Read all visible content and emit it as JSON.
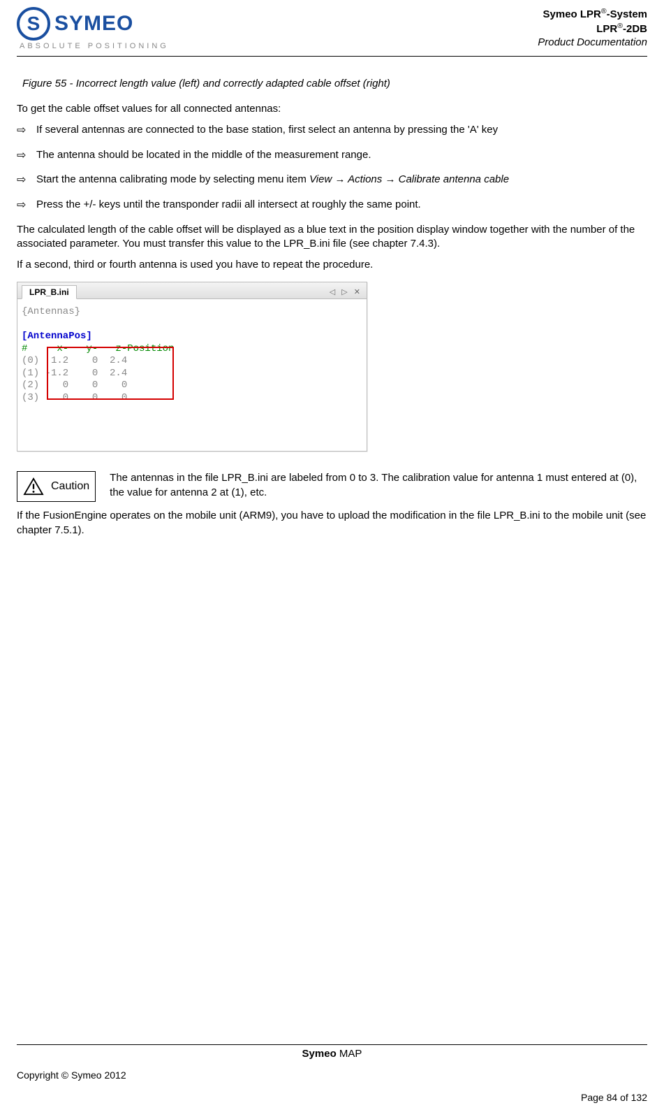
{
  "header": {
    "logo_letter": "S",
    "logo_name": "SYMEO",
    "logo_sub": "ABSOLUTE POSITIONING",
    "line1a": "Symeo LPR",
    "line1b": "-System",
    "line2a": "LPR",
    "line2b": "-2DB",
    "line3": "Product Documentation"
  },
  "figure_caption": "Figure 55 - Incorrect length value (left) and correctly adapted cable offset (right)",
  "intro": "To get the cable offset values for all connected antennas:",
  "bullets": [
    "If several antennas are connected to the base station, first select an antenna by pressing the 'A' key",
    "The antenna should be located in the middle of the measurement range.",
    "Start the antenna calibrating mode by selecting menu item ",
    "Press the +/- keys until the transponder radii all intersect at roughly the same point."
  ],
  "menu_path": "View → Actions → Calibrate antenna cable",
  "para_after_bullets": "The calculated length of the cable offset will be displayed as a blue text in the position display window together with the number of the associated parameter. You must transfer this value to the LPR_B.ini file (see chapter 7.4.3).",
  "para_repeat": "If a second, third or fourth antenna is used you have to repeat the procedure.",
  "ini": {
    "tab_label": "LPR_B.ini",
    "tab_controls": "◁ ▷ ✕",
    "line_section1": "{Antennas}",
    "line_section2": "[AntennaPos]",
    "line_header": "#     x-   y-   z-Position",
    "rows": [
      "(0)  1.2    0  2.4",
      "(1) -1.2    0  2.4",
      "(2)    0    0    0",
      "(3)    0    0    0"
    ]
  },
  "caution": {
    "label": "Caution",
    "text": "The antennas in the file LPR_B.ini are labeled from 0 to 3. The calibration value for antenna 1 must entered at (0), the value for antenna 2 at (1), etc."
  },
  "para_fusion": "If the FusionEngine operates on the mobile unit (ARM9), you have to upload the modification in the file LPR_B.ini to the mobile unit (see chapter 7.5.1).",
  "footer": {
    "center_a": "Symeo",
    "center_b": " MAP",
    "copyright": "Copyright © Symeo 2012",
    "page": "Page 84 of 132"
  }
}
